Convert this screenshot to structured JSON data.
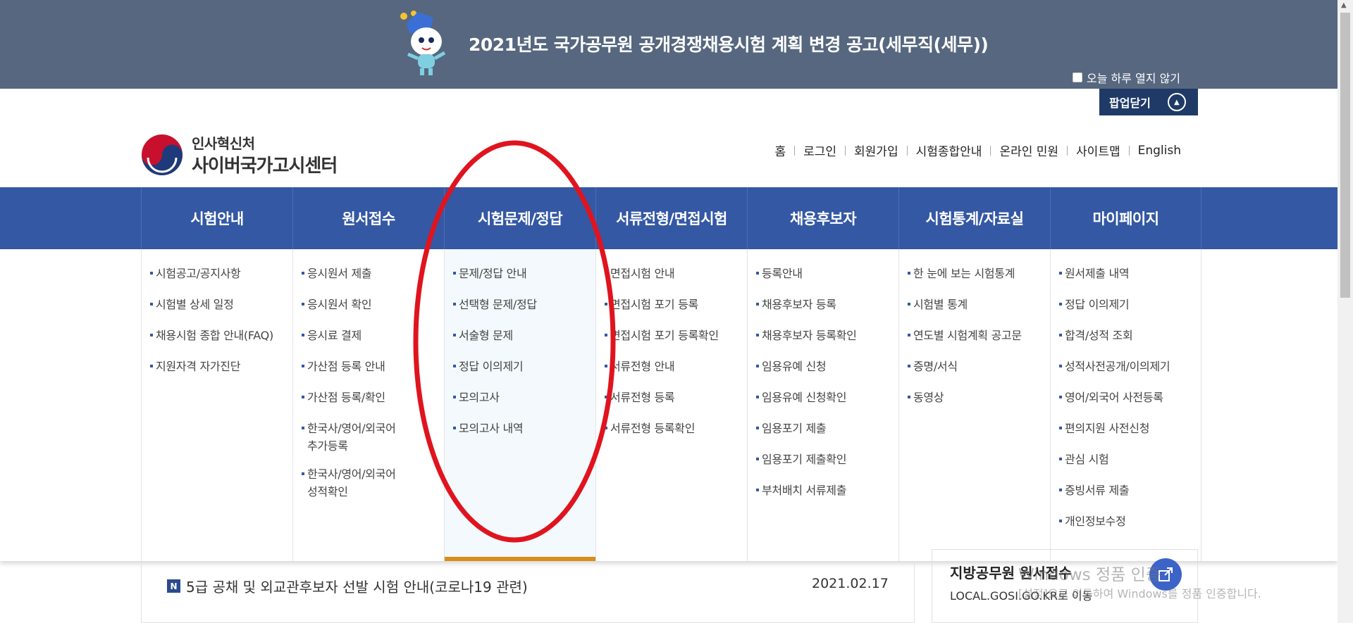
{
  "popup": {
    "title": "2021년도 국가공무원 공개경쟁채용시험 계획 변경 공고(세무직(세무))",
    "dont_show_today": "오늘 하루 열지 않기",
    "close_label": "팝업닫기"
  },
  "logo": {
    "org": "인사혁신처",
    "site": "사이버국가고시센터"
  },
  "util_nav": [
    "홈",
    "로그인",
    "회원가입",
    "시험종합안내",
    "온라인 민원",
    "사이트맵",
    "English"
  ],
  "gnb": [
    {
      "label": "시험안내",
      "items": [
        "시험공고/공지사항",
        "시험별 상세 일정",
        "채용시험 종합 안내(FAQ)",
        "지원자격 자가진단"
      ]
    },
    {
      "label": "원서접수",
      "items": [
        "응시원서 제출",
        "응시원서 확인",
        "응시료 결제",
        "가산점 등록 안내",
        "가산점 등록/확인",
        "한국사/영어/외국어 추가등록",
        "한국사/영어/외국어 성적확인"
      ]
    },
    {
      "label": "시험문제/정답",
      "items": [
        "문제/정답 안내",
        "선택형 문제/정답",
        "서술형 문제",
        "정답 이의제기",
        "모의고사",
        "모의고사 내역"
      ]
    },
    {
      "label": "서류전형/면접시험",
      "items": [
        "면접시험 안내",
        "면접시험 포기 등록",
        "면접시험 포기 등록확인",
        "서류전형 안내",
        "서류전형 등록",
        "서류전형 등록확인"
      ]
    },
    {
      "label": "채용후보자",
      "items": [
        "등록안내",
        "채용후보자 등록",
        "채용후보자 등록확인",
        "임용유예 신청",
        "임용유예 신청확인",
        "임용포기 제출",
        "임용포기 제출확인",
        "부처배치 서류제출"
      ]
    },
    {
      "label": "시험통계/자료실",
      "items": [
        "한 눈에 보는 시험통계",
        "시험별 통계",
        "연도별 시험계획 공고문",
        "증명/서식",
        "동영상"
      ]
    },
    {
      "label": "마이페이지",
      "items": [
        "원서제출 내역",
        "정답 이의제기",
        "합격/성적 조회",
        "성적사전공개/이의제기",
        "영어/외국어 사전등록",
        "편의지원 사전신청",
        "관심 시험",
        "증빙서류 제출",
        "개인정보수정"
      ]
    }
  ],
  "notice": {
    "badge": "N",
    "title": "5급 공채 및 외교관후보자 선발 시험 안내(코로나19 관련)",
    "date": "2021.02.17"
  },
  "local": {
    "title": "지방공무원 원서접수",
    "subtitle": "LOCAL.GOSI.GO.KR로 이동"
  },
  "watermark": {
    "line1": "Windows 정품 인증",
    "line2": "[설정]으로 이동하여 Windows를 정품 인증합니다."
  },
  "colors": {
    "popup_bg": "#56677f",
    "gnb_bg": "#3458a4",
    "active_underline": "#d98d18",
    "annotation": "#e0141e"
  }
}
